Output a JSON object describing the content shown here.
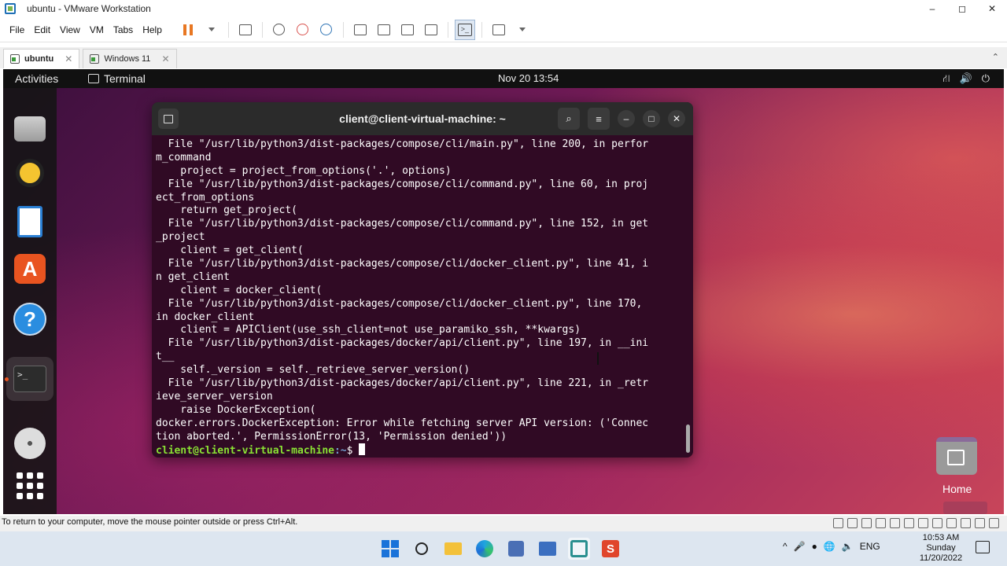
{
  "window": {
    "title": "ubuntu - VMware Workstation",
    "minimize": "–",
    "maximize": "◻",
    "close": "✕"
  },
  "menu": [
    "File",
    "Edit",
    "View",
    "VM",
    "Tabs",
    "Help"
  ],
  "tabs": [
    {
      "label": "ubuntu",
      "close": "✕"
    },
    {
      "label": "Windows 11",
      "close": "✕"
    }
  ],
  "tabs_collapse": "⌃",
  "ubuntu": {
    "activities": "Activities",
    "app_name": "Terminal",
    "datetime": "Nov 20  13:54",
    "sys_icons": [
      "⛙",
      "🔊",
      "⏻"
    ]
  },
  "terminal": {
    "title": "client@client-virtual-machine: ~",
    "search_btn": "⌕",
    "menu_btn": "≡",
    "min_btn": "–",
    "max_btn": "□",
    "close_btn": "✕",
    "lines": [
      "  File \"/usr/lib/python3/dist-packages/compose/cli/main.py\", line 200, in perfor",
      "m_command",
      "    project = project_from_options('.', options)",
      "  File \"/usr/lib/python3/dist-packages/compose/cli/command.py\", line 60, in proj",
      "ect_from_options",
      "    return get_project(",
      "  File \"/usr/lib/python3/dist-packages/compose/cli/command.py\", line 152, in get",
      "_project",
      "    client = get_client(",
      "  File \"/usr/lib/python3/dist-packages/compose/cli/docker_client.py\", line 41, i",
      "n get_client",
      "    client = docker_client(",
      "  File \"/usr/lib/python3/dist-packages/compose/cli/docker_client.py\", line 170,",
      "in docker_client",
      "    client = APIClient(use_ssh_client=not use_paramiko_ssh, **kwargs)",
      "  File \"/usr/lib/python3/dist-packages/docker/api/client.py\", line 197, in __ini",
      "t__",
      "    self._version = self._retrieve_server_version()",
      "  File \"/usr/lib/python3/dist-packages/docker/api/client.py\", line 221, in _retr",
      "ieve_server_version",
      "    raise DockerException(",
      "docker.errors.DockerException: Error while fetching server API version: ('Connec",
      "tion aborted.', PermissionError(13, 'Permission denied'))"
    ],
    "prompt_user": "client@client-virtual-machine",
    "prompt_path": ":~",
    "prompt_symbol": "$ "
  },
  "desktop": {
    "home_label": "Home"
  },
  "status_bar": {
    "text": "To return to your computer, move the mouse pointer outside or press Ctrl+Alt."
  },
  "taskbar": {
    "tray_lang": "ENG",
    "tray_icons": [
      "^",
      "🎤",
      "●",
      "🌐",
      "🔈"
    ],
    "time": "10:53 AM",
    "day": "Sunday",
    "date": "11/20/2022",
    "store_letter": "S"
  },
  "icons": {
    "dock_store": "A",
    "dock_help": "?",
    "dock_terminal": ">_"
  }
}
